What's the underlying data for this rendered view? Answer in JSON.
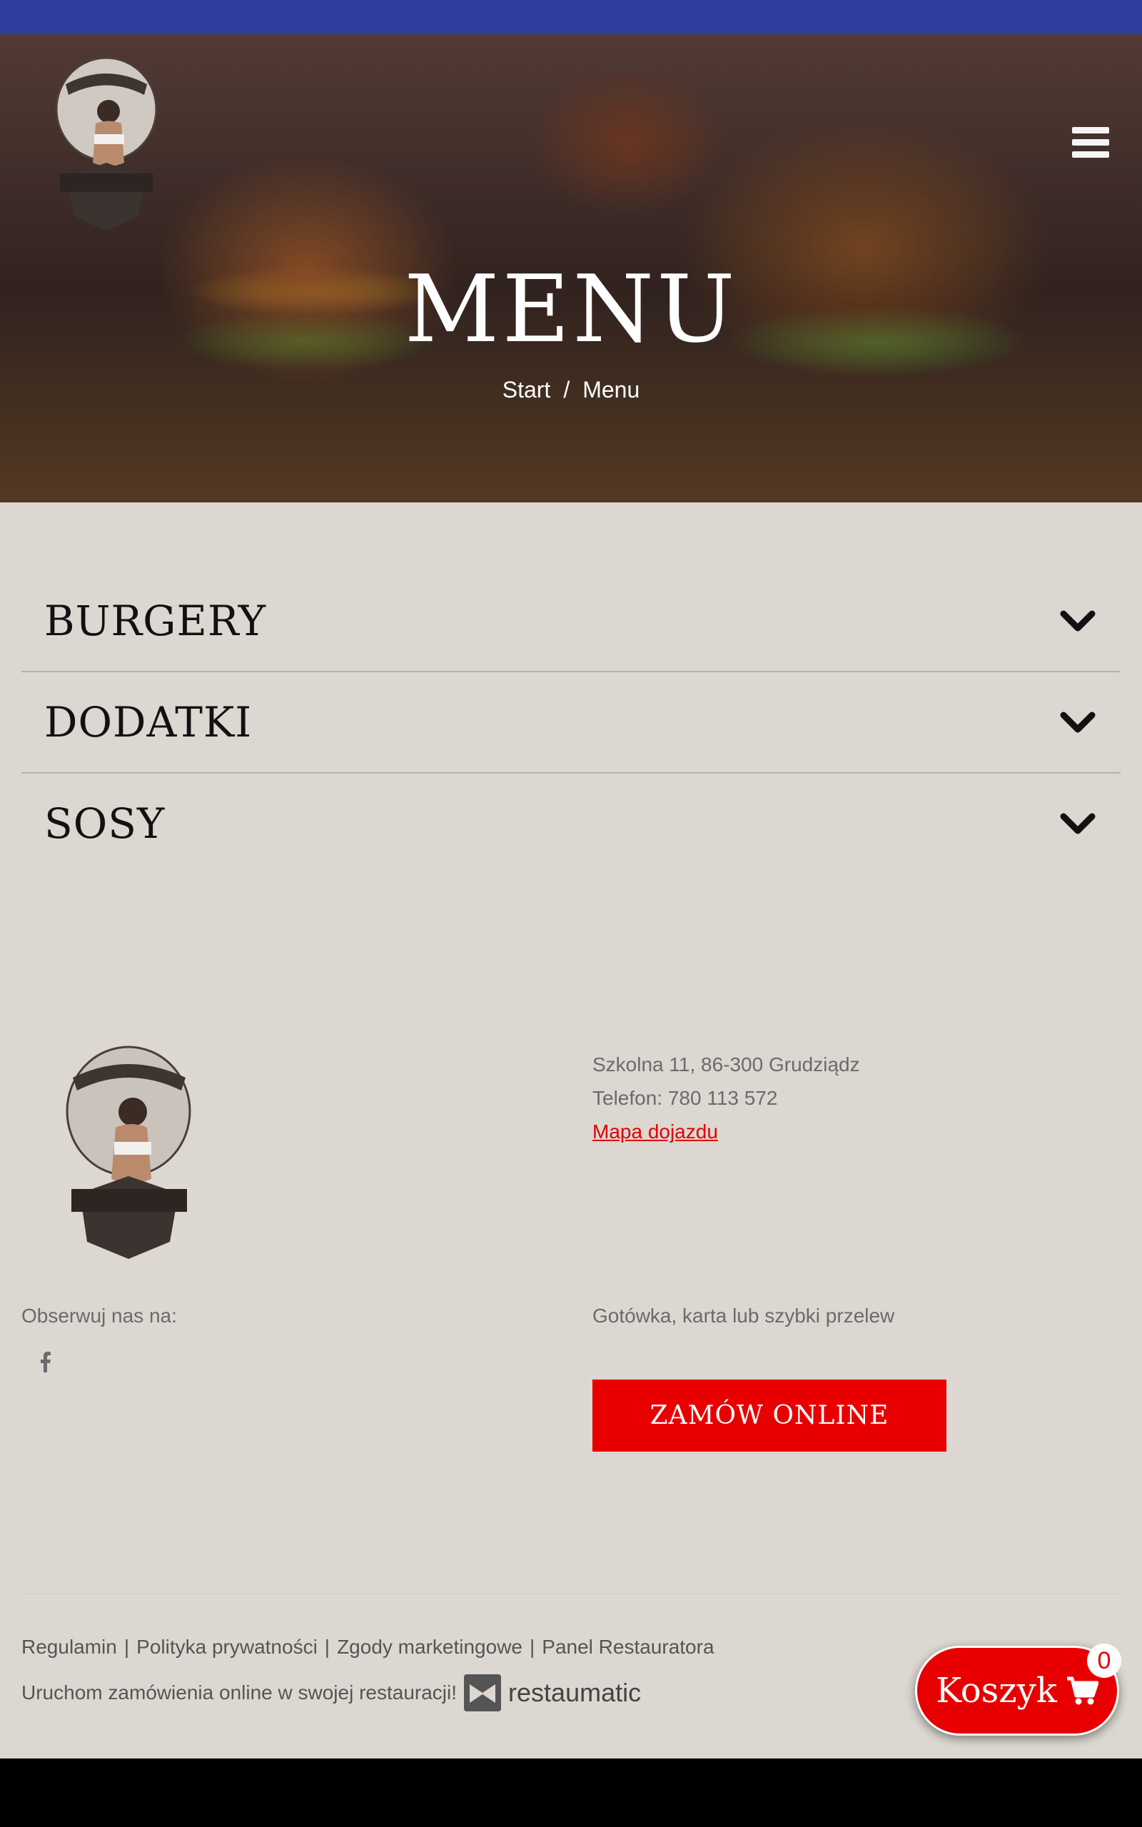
{
  "hero": {
    "title": "MENU",
    "breadcrumb": {
      "home": "Start",
      "separator": "/",
      "current": "Menu"
    }
  },
  "menu_categories": [
    {
      "label": "BURGERY"
    },
    {
      "label": "DODATKI"
    },
    {
      "label": "SOSY"
    }
  ],
  "contact": {
    "address": "Szkolna 11, 86-300 Grudziądz",
    "phone": "Telefon: 780 113 572",
    "map_link": "Mapa dojazdu"
  },
  "social": {
    "follow_label": "Obserwuj nas na:",
    "icons": [
      "facebook-icon"
    ]
  },
  "payment": {
    "text": "Gotówka, karta lub szybki przelew"
  },
  "order_button": "ZAMÓW ONLINE",
  "legal_links": [
    "Regulamin",
    "Polityka prywatności",
    "Zgody marketingowe",
    "Panel Restauratora"
  ],
  "legal_separator": "|",
  "promo": {
    "text": "Uruchom zamówienia online w swojej restauracji!",
    "brand": "restaumatic"
  },
  "cart": {
    "label": "Koszyk",
    "count": "0"
  },
  "colors": {
    "top_bar": "#2f3d9e",
    "background": "#dcd7d1",
    "accent_red": "#e80000",
    "bottom_bar": "#000000"
  }
}
